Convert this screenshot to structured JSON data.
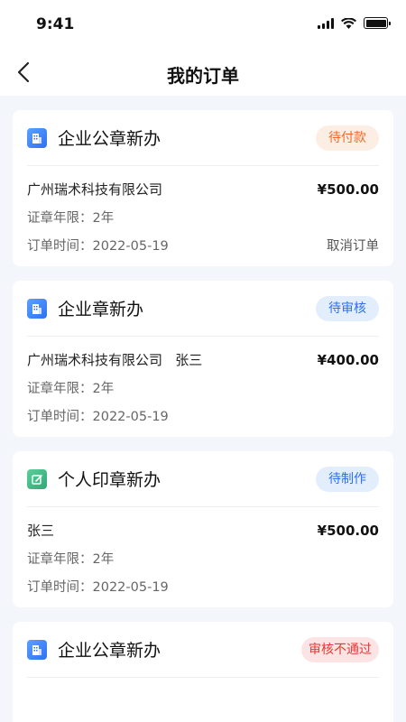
{
  "status_bar": {
    "time": "9:41"
  },
  "nav": {
    "title": "我的订单"
  },
  "orders": [
    {
      "title": "企业公章新办",
      "icon": "building-icon",
      "status": "待付款",
      "company": "广州瑞术科技有限公司",
      "price": "¥500.00",
      "years": "证章年限：2年",
      "time": "订单时间：2022-05-19",
      "action": "取消订单"
    },
    {
      "title": "企业章新办",
      "icon": "building-icon",
      "status": "待审核",
      "company": "广州瑞术科技有限公司   张三",
      "price": "¥400.00",
      "years": "证章年限：2年",
      "time": "订单时间：2022-05-19"
    },
    {
      "title": "个人印章新办",
      "icon": "edit-icon",
      "status": "待制作",
      "company": "张三",
      "price": "¥500.00",
      "years": "证章年限：2年",
      "time": "订单时间：2022-05-19"
    },
    {
      "title": "企业公章新办",
      "icon": "building-icon",
      "status": "审核不通过"
    }
  ]
}
